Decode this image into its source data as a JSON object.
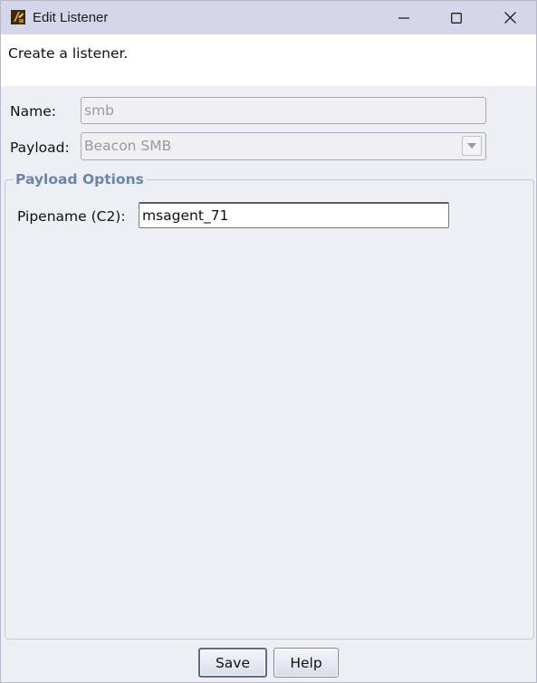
{
  "window": {
    "title": "Edit Listener",
    "app_icon": "cobalt-strike-icon",
    "controls": {
      "minimize_icon": "minimize-icon",
      "maximize_icon": "maximize-icon",
      "close_icon": "close-icon"
    }
  },
  "description": "Create a listener.",
  "form": {
    "name_label": "Name:",
    "name_value": "smb",
    "payload_label": "Payload:",
    "payload_selected": "Beacon SMB"
  },
  "payload_options": {
    "title": "Payload Options",
    "pipename_label": "Pipename (C2):",
    "pipename_value": "msagent_71"
  },
  "buttons": {
    "save": "Save",
    "help": "Help"
  },
  "colors": {
    "titlebar": "#d6d6ea",
    "background": "#eeeef5",
    "group_title": "#6a86a8"
  }
}
